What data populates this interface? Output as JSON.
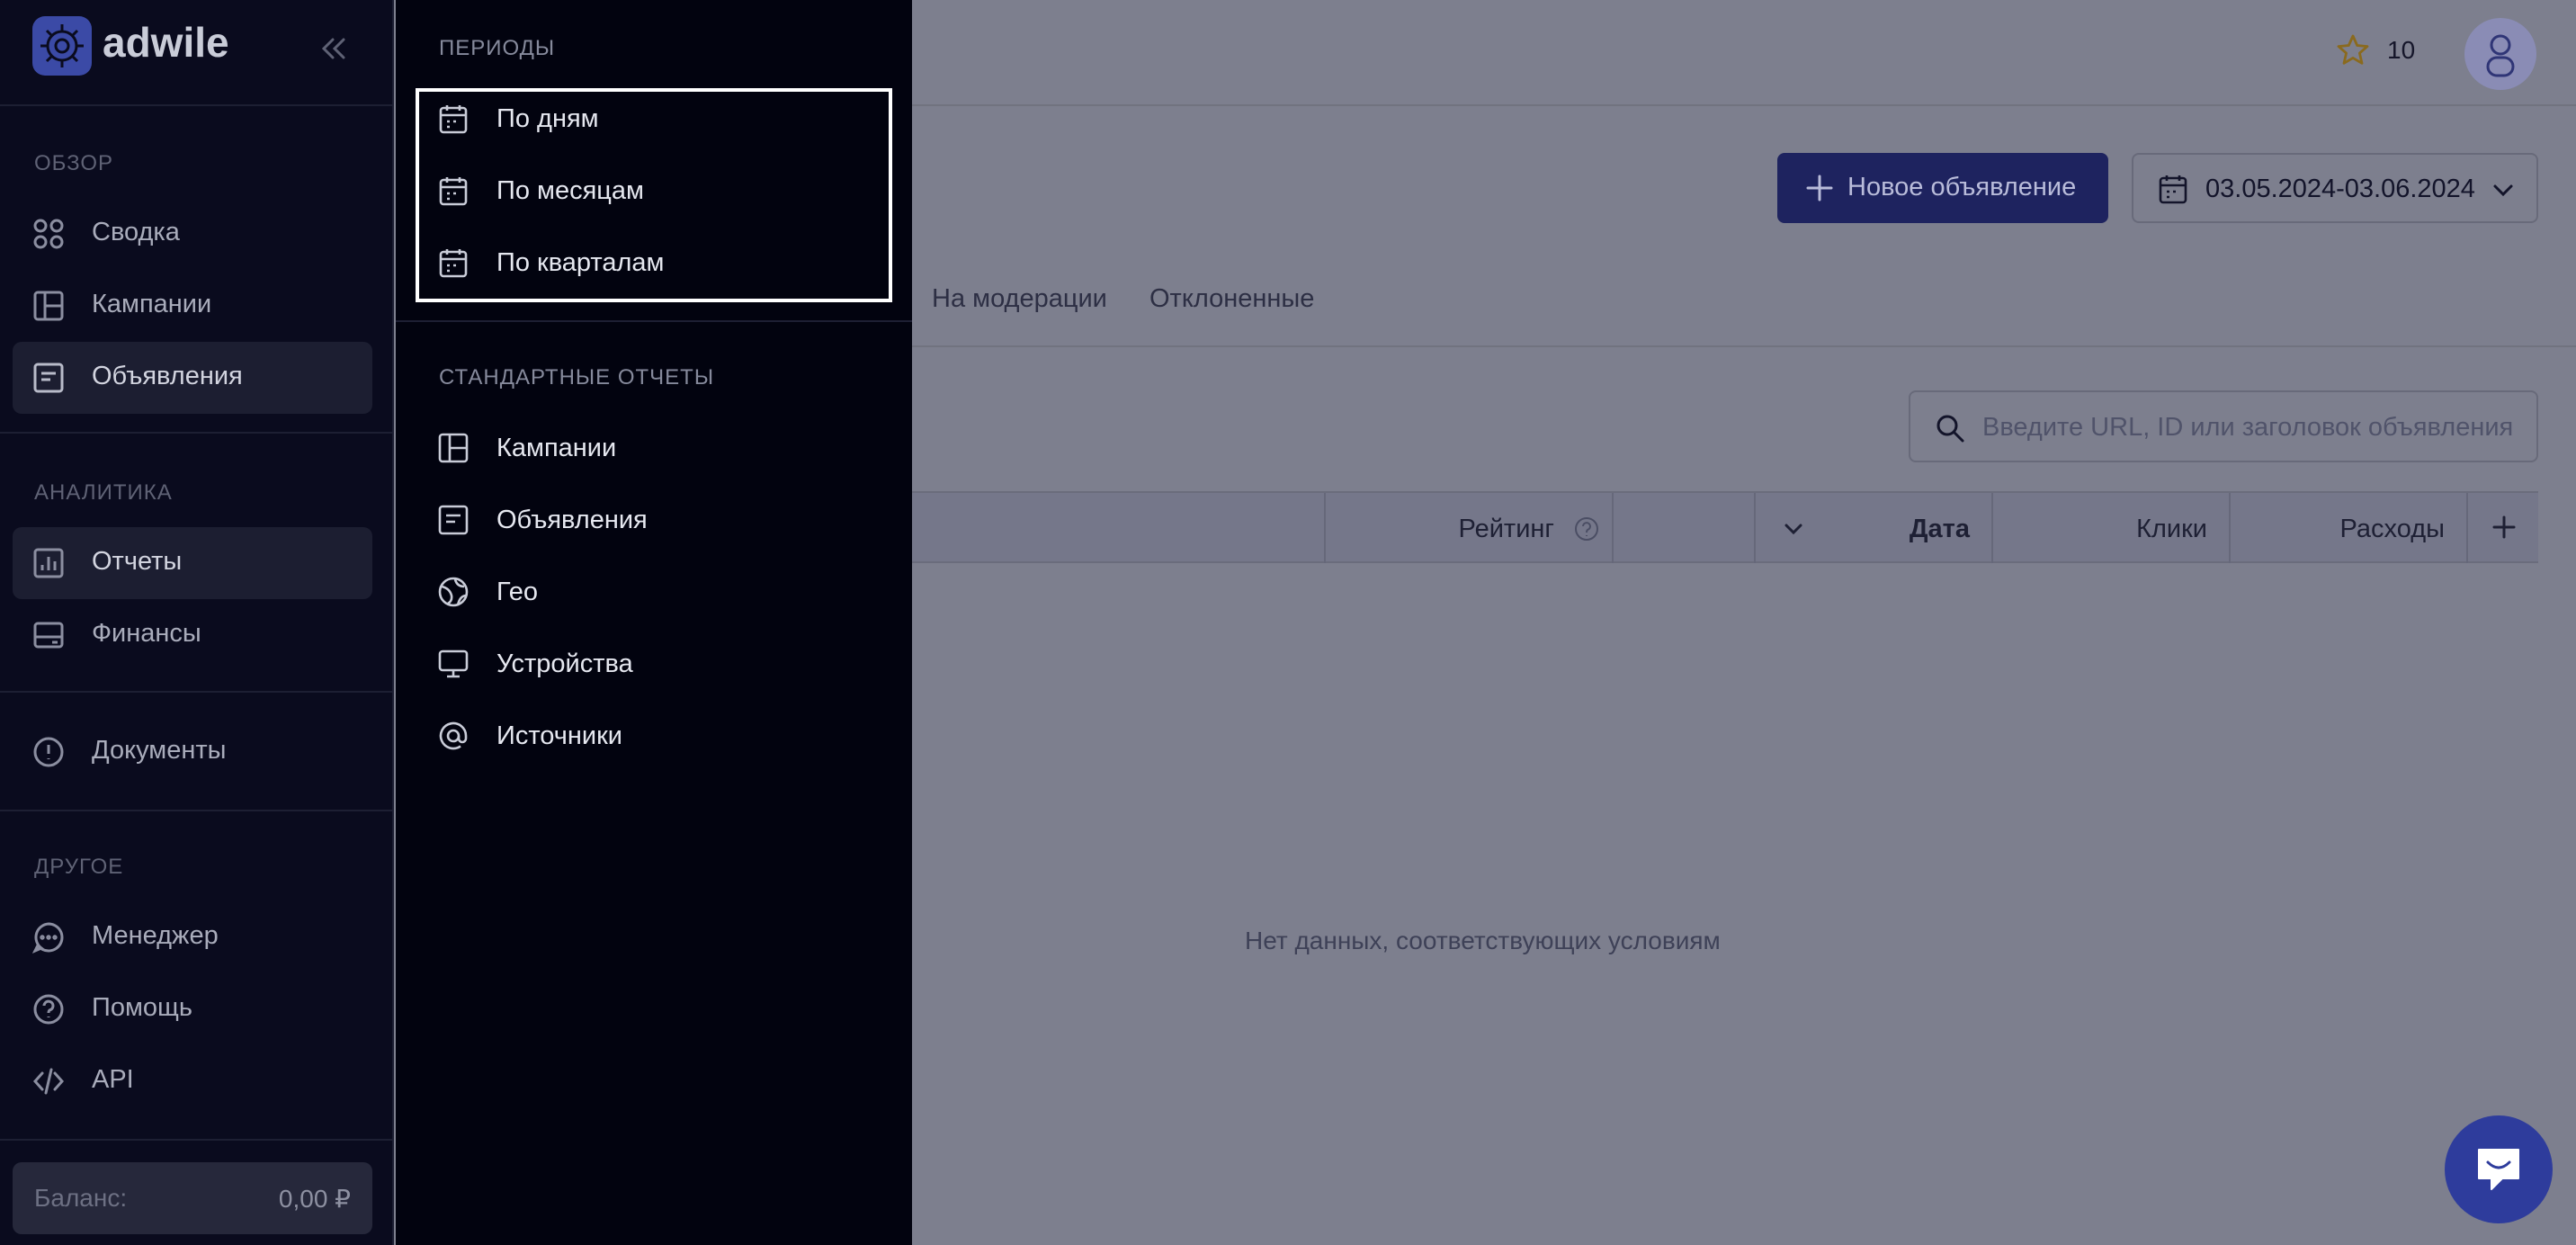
{
  "sidebar": {
    "brand": "adwile",
    "sections": {
      "overview": "ОБЗОР",
      "analytics": "АНАЛИТИКА",
      "other": "ДРУГОЕ"
    },
    "items": [
      {
        "label": "Сводка",
        "icon": "grid-circles-icon"
      },
      {
        "label": "Кампании",
        "icon": "layout-icon"
      },
      {
        "label": "Объявления",
        "icon": "document-icon",
        "active": true
      },
      {
        "label": "Отчеты",
        "icon": "chart-icon",
        "active": true
      },
      {
        "label": "Финансы",
        "icon": "wallet-icon"
      },
      {
        "label": "Документы",
        "icon": "alert-circle-icon"
      },
      {
        "label": "Менеджер",
        "icon": "chat-icon"
      },
      {
        "label": "Помощь",
        "icon": "help-icon"
      },
      {
        "label": "API",
        "icon": "code-icon"
      }
    ],
    "balance": {
      "label": "Баланс:",
      "value": "0,00 ₽"
    }
  },
  "reports_menu": {
    "periods_header": "ПЕРИОДЫ",
    "periods": [
      {
        "label": "По дням",
        "icon": "calendar-icon"
      },
      {
        "label": "По месяцам",
        "icon": "calendar-icon"
      },
      {
        "label": "По кварталам",
        "icon": "calendar-icon"
      }
    ],
    "standard_header": "СТАНДАРТНЫЕ ОТЧЕТЫ",
    "standard": [
      {
        "label": "Кампании",
        "icon": "layout-icon"
      },
      {
        "label": "Объявления",
        "icon": "document-icon"
      },
      {
        "label": "Гео",
        "icon": "globe-icon"
      },
      {
        "label": "Устройства",
        "icon": "monitor-icon"
      },
      {
        "label": "Источники",
        "icon": "at-icon"
      }
    ]
  },
  "topbar": {
    "stars": "10"
  },
  "toolbar": {
    "new_ad": "Новое объявление",
    "date_range": "03.05.2024-03.06.2024"
  },
  "tabs": [
    "На модерации",
    "Отклоненные"
  ],
  "search": {
    "placeholder": "Введите URL, ID или заголовок объявления"
  },
  "table": {
    "columns": [
      "Рейтинг",
      "Дата",
      "Клики",
      "Расходы"
    ],
    "empty": "Нет данных, соответствующих условиям"
  },
  "colors": {
    "accent": "#1e235f",
    "sidebar_bg": "#0a0b1e",
    "popup_bg": "#02030f"
  }
}
